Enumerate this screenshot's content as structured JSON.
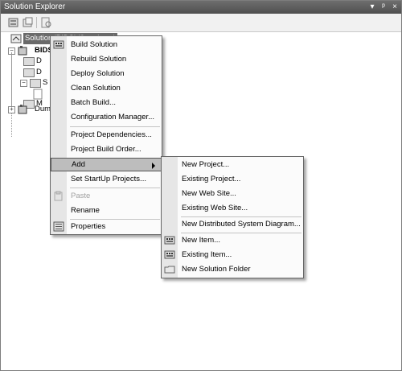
{
  "window": {
    "title": "Solution Explorer",
    "pin_glyph": "▾",
    "autohide_glyph": "ᵖ",
    "close_glyph": "×"
  },
  "tree": {
    "solution_label": "Solution 'BIDS' (2 projects)",
    "project_label": "BIDS",
    "folder_labels": [
      "D",
      "D",
      "S",
      "M"
    ],
    "project2_label": "Dumm",
    "collapsed": "+",
    "expanded": "−"
  },
  "context_menu": {
    "items": [
      "Build Solution",
      "Rebuild Solution",
      "Deploy Solution",
      "Clean Solution",
      "Batch Build...",
      "Configuration Manager...",
      "Project Dependencies...",
      "Project Build Order...",
      "Add",
      "Set StartUp Projects...",
      "Paste",
      "Rename",
      "Properties"
    ]
  },
  "add_submenu": {
    "items": [
      "New Project...",
      "Existing Project...",
      "New Web Site...",
      "Existing Web Site...",
      "New Distributed System Diagram...",
      "New Item...",
      "Existing Item...",
      "New Solution Folder"
    ]
  }
}
